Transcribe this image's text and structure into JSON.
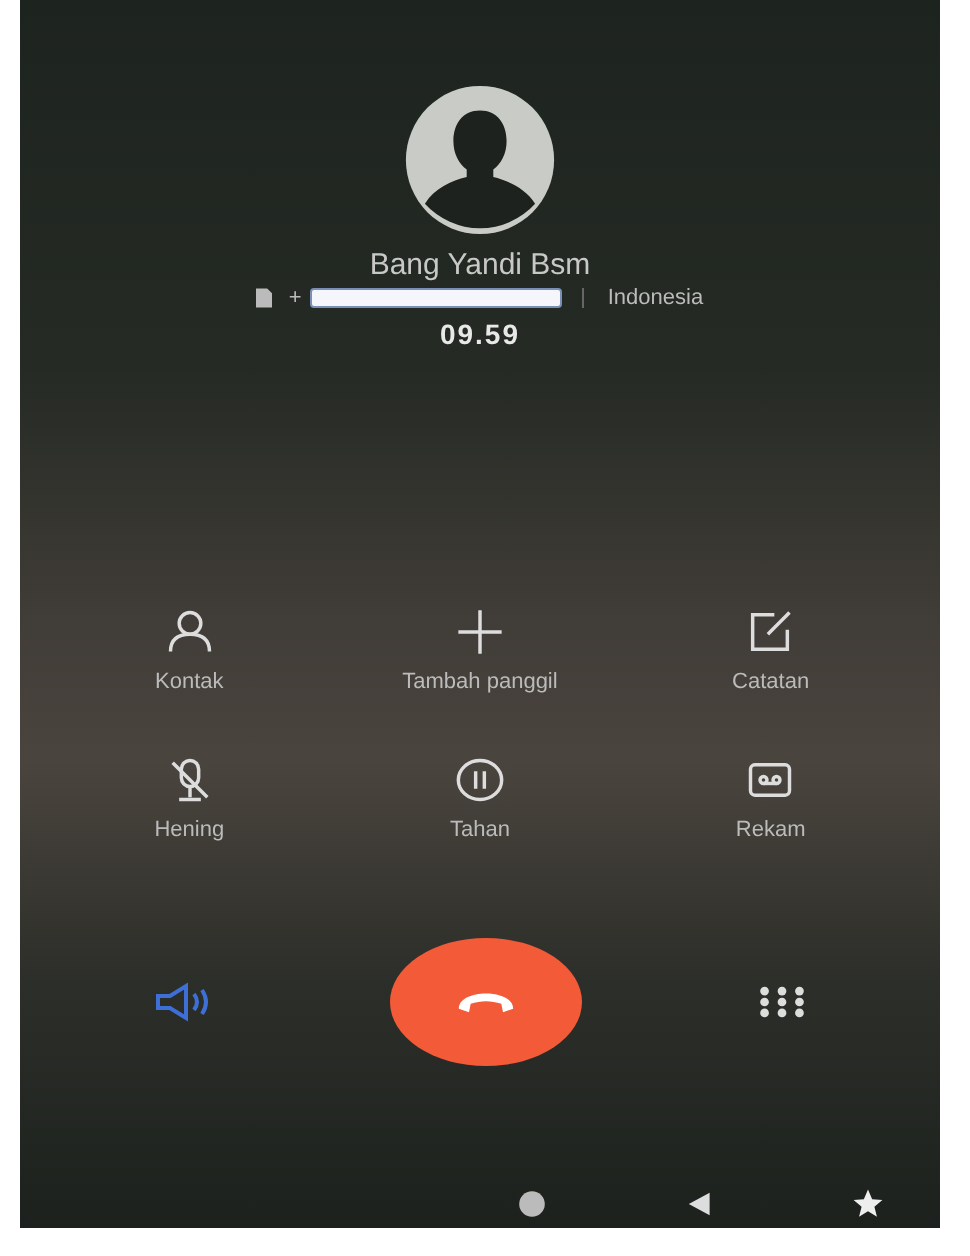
{
  "caller": {
    "name": "Bang Yandi Bsm",
    "number_prefix": "+",
    "number_redacted": true,
    "region": "Indonesia",
    "duration": "09.59"
  },
  "actions": [
    {
      "label": "Kontak",
      "kind": "contact"
    },
    {
      "label": "Tambah panggil",
      "kind": "add"
    },
    {
      "label": "Catatan",
      "kind": "note"
    },
    {
      "label": "Hening",
      "kind": "mute"
    },
    {
      "label": "Tahan",
      "kind": "hold"
    },
    {
      "label": "Rekam",
      "kind": "record"
    }
  ],
  "speaker": {
    "on": true
  }
}
